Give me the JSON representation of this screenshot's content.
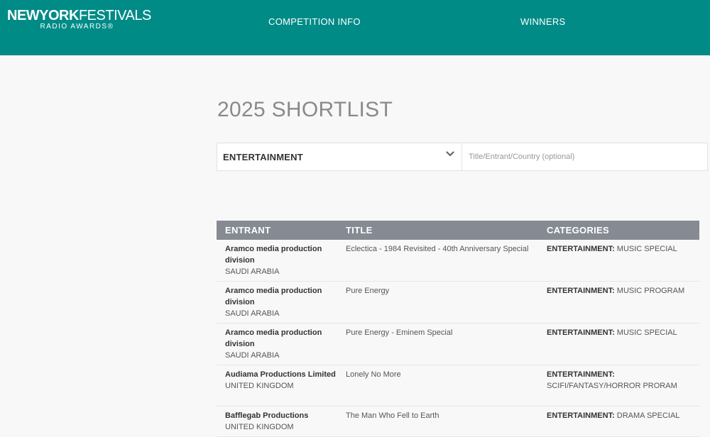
{
  "header": {
    "logo_bold": "NEWYORK",
    "logo_light": "FESTIVALS",
    "logo_sub": "RADIO AWARDS®",
    "nav": [
      {
        "label": "COMPETITION INFO"
      },
      {
        "label": "WINNERS"
      }
    ]
  },
  "page_title": "2025 SHORTLIST",
  "filter": {
    "selected_category": "ENTERTAINMENT",
    "search_placeholder": "Title/Entrant/Country (optional)",
    "search_value": ""
  },
  "table": {
    "columns": [
      "ENTRANT",
      "TITLE",
      "CATEGORIES"
    ],
    "rows": [
      {
        "entrant": "Aramco media production division",
        "country": "SAUDI ARABIA",
        "title": "Eclectica - 1984 Revisited - 40th Anniversary Special",
        "category_main": "ENTERTAINMENT:",
        "category_sub": " MUSIC SPECIAL"
      },
      {
        "entrant": "Aramco media production division",
        "country": "SAUDI ARABIA",
        "title": "Pure Energy",
        "category_main": "ENTERTAINMENT:",
        "category_sub": " MUSIC PROGRAM"
      },
      {
        "entrant": "Aramco media production division",
        "country": "SAUDI ARABIA",
        "title": "Pure Energy - Eminem Special",
        "category_main": "ENTERTAINMENT:",
        "category_sub": " MUSIC SPECIAL"
      },
      {
        "entrant": "Audiama Productions Limited",
        "country": "UNITED KINGDOM",
        "title": "Lonely No More",
        "category_main": "ENTERTAINMENT:",
        "category_sub": " SCIFI/FANTASY/HORROR PRORAM"
      },
      {
        "entrant": "Bafflegab Productions",
        "country": "UNITED KINGDOM",
        "title": "The Man Who Fell to Earth",
        "category_main": "ENTERTAINMENT:",
        "category_sub": " DRAMA SPECIAL"
      }
    ]
  },
  "colors": {
    "header_bg": "#008b87",
    "table_header_bg": "#858a93",
    "page_bg": "#f8f8f8"
  },
  "icons": {
    "select_chevron": "chevron-down-icon"
  }
}
